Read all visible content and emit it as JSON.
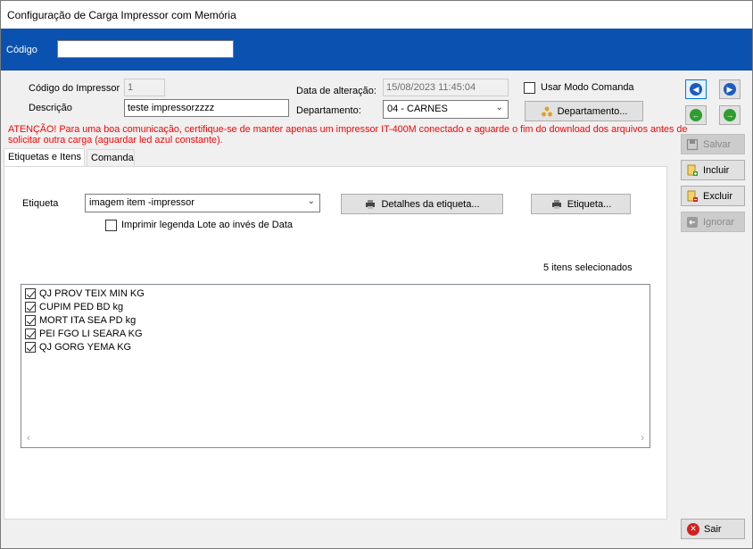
{
  "window": {
    "title": "Configuração de Carga Impressor com Memória"
  },
  "codigo": {
    "label": "Código",
    "value": ""
  },
  "form": {
    "codigo_impressor_label": "Código do Impressor",
    "codigo_impressor_value": "1",
    "descricao_label": "Descrição",
    "descricao_value": "teste impressorzzzz",
    "data_alteracao_label": "Data de alteração:",
    "data_alteracao_value": "15/08/2023 11:45:04",
    "departamento_label": "Departamento:",
    "departamento_value": "04 - CARNES",
    "usar_modo_comanda_label": "Usar Modo Comanda",
    "departamento_button": "Departamento..."
  },
  "warning": "ATENÇÃO! Para uma boa comunicação, certifique-se de manter apenas um impressor IT-400M conectado e aguarde o fim do download dos arquivos antes de solicitar outra carga (aguardar led azul constante).",
  "tabs": [
    {
      "label": "Etiquetas e Itens"
    },
    {
      "label": "Comanda"
    }
  ],
  "etiquetas": {
    "etiqueta_label": "Etiqueta",
    "etiqueta_value": "imagem item -impressor",
    "detalhes_button": "Detalhes da etiqueta...",
    "etiqueta_button": "Etiqueta...",
    "imprimir_legenda_label": "Imprimir legenda Lote ao invés de Data",
    "selected_count": "5 itens selecionados",
    "items": [
      {
        "label": "QJ PROV TEIX MIN KG"
      },
      {
        "label": "CUPIM PED BD kg"
      },
      {
        "label": "MORT ITA SEA PD kg"
      },
      {
        "label": "PEI FGO LI SEARA KG"
      },
      {
        "label": "QJ GORG YEMA KG"
      }
    ]
  },
  "side": {
    "salvar": "Salvar",
    "incluir": "Incluir",
    "excluir": "Excluir",
    "ignorar": "Ignorar",
    "sair": "Sair"
  },
  "colors": {
    "band": "#0a51b0",
    "warning": "#ff0000"
  }
}
